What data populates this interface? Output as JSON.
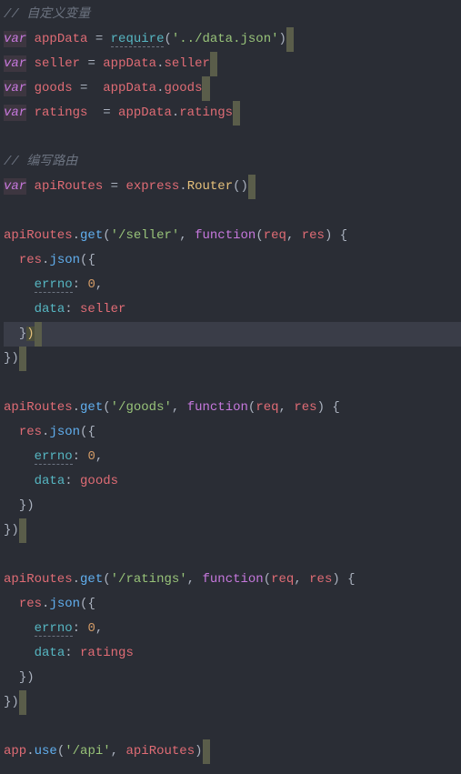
{
  "comments": {
    "custom_vars": "// 自定义变量",
    "write_routes": "// 编写路由"
  },
  "declarations": {
    "var_kw": "var",
    "appData": "appData",
    "seller": "seller",
    "goods": "goods",
    "ratings": "ratings",
    "apiRoutes": "apiRoutes",
    "require": "require",
    "express": "express",
    "router": "Router"
  },
  "strings": {
    "data_json": "'../data.json'",
    "seller_route": "'/seller'",
    "goods_route": "'/goods'",
    "ratings_route": "'/ratings'",
    "api_route": "'/api'"
  },
  "keywords": {
    "function": "function"
  },
  "params": {
    "req": "req",
    "res": "res"
  },
  "methods": {
    "get": "get",
    "json": "json",
    "use": "use"
  },
  "props": {
    "errno": "errno",
    "data": "data",
    "app": "app"
  },
  "values": {
    "zero": "0"
  },
  "punct": {
    "eq": " = ",
    "dot": ".",
    "comma": ",",
    "colon": ": ",
    "open_paren": "(",
    "close_paren": ")",
    "open_brace": "{",
    "close_brace": "}",
    "close_paren_brace": "})"
  }
}
